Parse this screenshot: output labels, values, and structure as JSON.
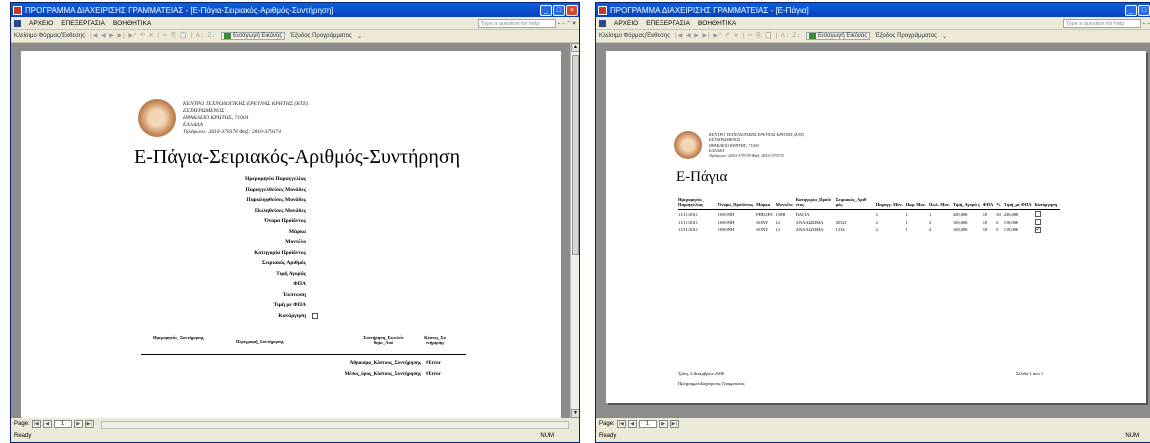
{
  "w1": {
    "title": "ΠΡΟΓΡΑΜΜΑ ΔΙΑΧΕΙΡΙΣΗΣ ΓΡΑΜΜΑΤΕΙΑΣ - [Ε-Πάγια-Σειριακός-Αριθμός-Συντήρηση]",
    "report_title": "Ε-Πάγια-Σειριακός-Αριθμός-Συντήρηση",
    "fields": [
      "Ημερομηνία Παραγγελίας",
      "Παραγγελθείσες Μονάδες",
      "Παραληφθείσες Μονάδες",
      "Πωληθείσες Μονάδες",
      "Όνομα Προϊόντος",
      "Μάρκα",
      "Μοντέλο",
      "Κατηγορία Προϊόντος",
      "Σειριακός Αριθμός",
      "Τιμή Αγοράς",
      "ΦΠΑ",
      "Έκπτωση",
      "Τιμή με ΦΠΑ",
      "Κατάργηση"
    ],
    "sub_headers": [
      "Ημερομηνία_ Συντήρησης",
      "Περιγραφή_Συντήρησης",
      "Συντήρηση_Εκτελέσ θηκε_Από",
      "Κόστος_Συ ντήρησης"
    ],
    "sum1_label": "Άθροισμα_Κόστους_Συντήρησης",
    "sum1_value": "#Error",
    "sum2_label": "Μέσος_όρος_Κόστους_Συντήρησης",
    "sum2_value": "#Error",
    "page_num": "1"
  },
  "w2": {
    "title": "ΠΡΟΓΡΑΜΜΑ ΔΙΑΧΕΙΡΙΣΗΣ ΓΡΑΜΜΑΤΕΙΑΣ - [Ε-Πάγια]",
    "report_title": "Ε-Πάγια",
    "headers": [
      "Ημερομηνία_ Παραγγελίας",
      "Όνομα_Προϊόντος",
      "Μάρκα",
      "Μοντέλο",
      "Κατηγορία_Προϊό ντος",
      "Σειριακός_Αριθ μός",
      "Παραγγ. Μον.",
      "Παρ. Μον.",
      "Πωλ. Μον.",
      "Τιμή_Αγορά ς",
      "ΦΠΑ",
      "%",
      "Τιμή_με ΦΠΑ",
      "Κατάργηση"
    ],
    "rows": [
      [
        "11/11/2011",
        "ΟΘΟΝΗ",
        "PHILIPS",
        "150B",
        "ΠΑΓΙΑ",
        "",
        "2",
        "1",
        "1",
        "200,00€",
        "18",
        "50",
        "236,00€",
        false
      ],
      [
        "11/11/2011",
        "ΟΘΟΝΗ",
        "SONY",
        "12",
        "ΑΝΑΛΩΣΙΜΑ",
        "45321",
        "2",
        "1",
        "2",
        "100,00€",
        "18",
        "0",
        "118,00€",
        false
      ],
      [
        "11/11/2011",
        "ΟΘΟΝΗ",
        "SONY",
        "12",
        "ΑΝΑΛΩΣΙΜΑ",
        "1234",
        "2",
        "1",
        "2",
        "100,00€",
        "18",
        "0",
        "118,00€",
        true
      ]
    ],
    "footer_date": "Τρίτη, 5 Δεκεμβρίου 2006",
    "footer_page": "Σελίδα 1 από 1",
    "footer_note": "Πρόγραμμα Διαχείρισης Γραμματείας",
    "page_num": "1"
  },
  "common": {
    "menu": [
      "ΑΡΧΕΙΟ",
      "ΕΠΕΞΕΡΓΑΣΙΑ",
      "ΒΟΗΘΗΤΙΚΑ"
    ],
    "help_placeholder": "Type a question for help",
    "toolbar_view": "Κλείσιμο Φόρμας/Έκθεσης",
    "toolbar_btn1": "Εισαγωγή Εικόνας",
    "toolbar_btn2": "Έξοδος Προγράμματος",
    "page_label": "Page:",
    "status_ready": "Ready",
    "status_num": "NUM",
    "addr": [
      "ΚΕΝΤΡΟ ΤΕΧΝΟΛΟΓΙΚΗΣ ΕΡΕΥΝΑΣ ΚΡΗΤΗΣ (ΚΤΕ)",
      "ΕΣΤΑΥΡΩΜΕΝΟΣ",
      "ΗΡΑΚΛΕΙΟ ΚΡΗΤΗΣ, 71004",
      "ΕΛΛΑΔΑ",
      "Τηλέφωνο: 2810-379378 Φαξ: 2810-379374"
    ]
  }
}
